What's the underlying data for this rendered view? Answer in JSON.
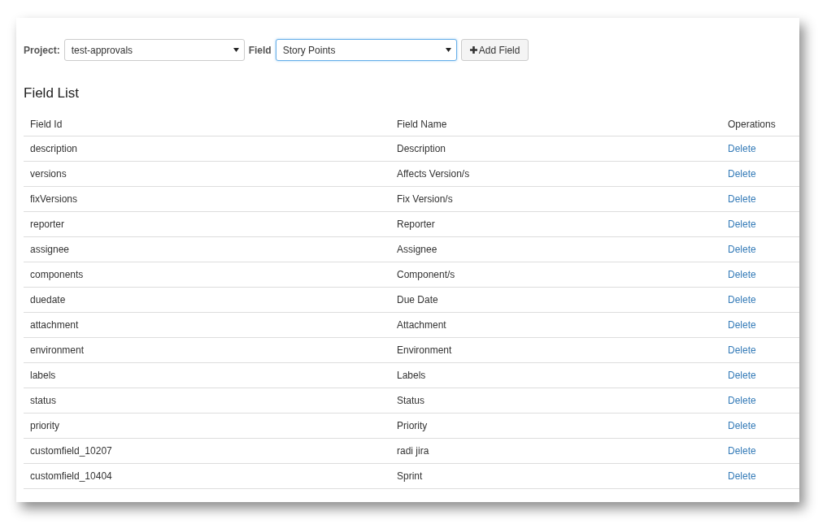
{
  "toolbar": {
    "project_label": "Project:",
    "project_value": "test-approvals",
    "field_label": "Field",
    "field_value": "Story Points",
    "add_button": "Add Field"
  },
  "heading": "Field List",
  "table": {
    "columns": [
      "Field Id",
      "Field Name",
      "Operations"
    ],
    "rows": [
      {
        "id": "description",
        "name": "Description",
        "operation": "Delete"
      },
      {
        "id": "versions",
        "name": "Affects Version/s",
        "operation": "Delete"
      },
      {
        "id": "fixVersions",
        "name": "Fix Version/s",
        "operation": "Delete"
      },
      {
        "id": "reporter",
        "name": "Reporter",
        "operation": "Delete"
      },
      {
        "id": "assignee",
        "name": "Assignee",
        "operation": "Delete"
      },
      {
        "id": "components",
        "name": "Component/s",
        "operation": "Delete"
      },
      {
        "id": "duedate",
        "name": "Due Date",
        "operation": "Delete"
      },
      {
        "id": "attachment",
        "name": "Attachment",
        "operation": "Delete"
      },
      {
        "id": "environment",
        "name": "Environment",
        "operation": "Delete"
      },
      {
        "id": "labels",
        "name": "Labels",
        "operation": "Delete"
      },
      {
        "id": "status",
        "name": "Status",
        "operation": "Delete"
      },
      {
        "id": "priority",
        "name": "Priority",
        "operation": "Delete"
      },
      {
        "id": "customfield_10207",
        "name": "radi jira",
        "operation": "Delete"
      },
      {
        "id": "customfield_10404",
        "name": "Sprint",
        "operation": "Delete"
      }
    ]
  }
}
